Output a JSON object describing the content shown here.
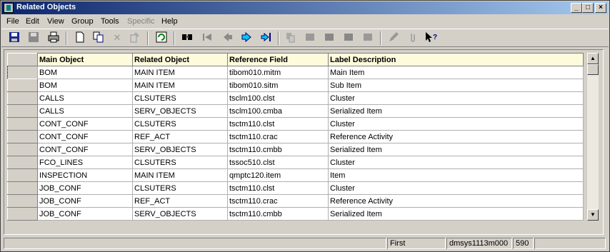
{
  "window": {
    "title": "Related Objects"
  },
  "window_buttons": {
    "minimize": "_",
    "maximize": "□",
    "close": "×"
  },
  "menu": [
    "File",
    "Edit",
    "View",
    "Group",
    "Tools",
    "Specific",
    "Help"
  ],
  "toolbar_icons": [
    "save-floppy-icon",
    "print-icon",
    "new-document-icon",
    "copy-icon",
    "delete-icon",
    "change-icon",
    "refresh-icon",
    "find-icon",
    "first-record-icon",
    "previous-record-icon",
    "next-record-icon",
    "last-record-icon",
    "paperclip-icon",
    "help-pointer-icon"
  ],
  "grid": {
    "columns": [
      "Main Object",
      "Related Object",
      "Reference Field",
      "Label Description"
    ],
    "rows": [
      [
        "BOM",
        "MAIN ITEM",
        "tibom010.mitm",
        "Main Item"
      ],
      [
        "BOM",
        "MAIN ITEM",
        "tibom010.sitm",
        "Sub Item"
      ],
      [
        "CALLS",
        "CLSUTERS",
        "tsclm100.clst",
        "Cluster"
      ],
      [
        "CALLS",
        "SERV_OBJECTS",
        "tsclm100.cmba",
        "Serialized Item"
      ],
      [
        "CONT_CONF",
        "CLSUTERS",
        "tsctm110.clst",
        "Cluster"
      ],
      [
        "CONT_CONF",
        "REF_ACT",
        "tsctm110.crac",
        "Reference Activity"
      ],
      [
        "CONT_CONF",
        "SERV_OBJECTS",
        "tsctm110.cmbb",
        "Serialized Item"
      ],
      [
        "FCO_LINES",
        "CLSUTERS",
        "tssoc510.clst",
        "Cluster"
      ],
      [
        "INSPECTION",
        "MAIN ITEM",
        "qmptc120.item",
        "Item"
      ],
      [
        "JOB_CONF",
        "CLSUTERS",
        "tsctm110.clst",
        "Cluster"
      ],
      [
        "JOB_CONF",
        "REF_ACT",
        "tsctm110.crac",
        "Reference Activity"
      ],
      [
        "JOB_CONF",
        "SERV_OBJECTS",
        "tsctm110.cmbb",
        "Serialized Item"
      ]
    ]
  },
  "status": {
    "position": "First",
    "session": "dmsys1113m000",
    "company": "590"
  }
}
